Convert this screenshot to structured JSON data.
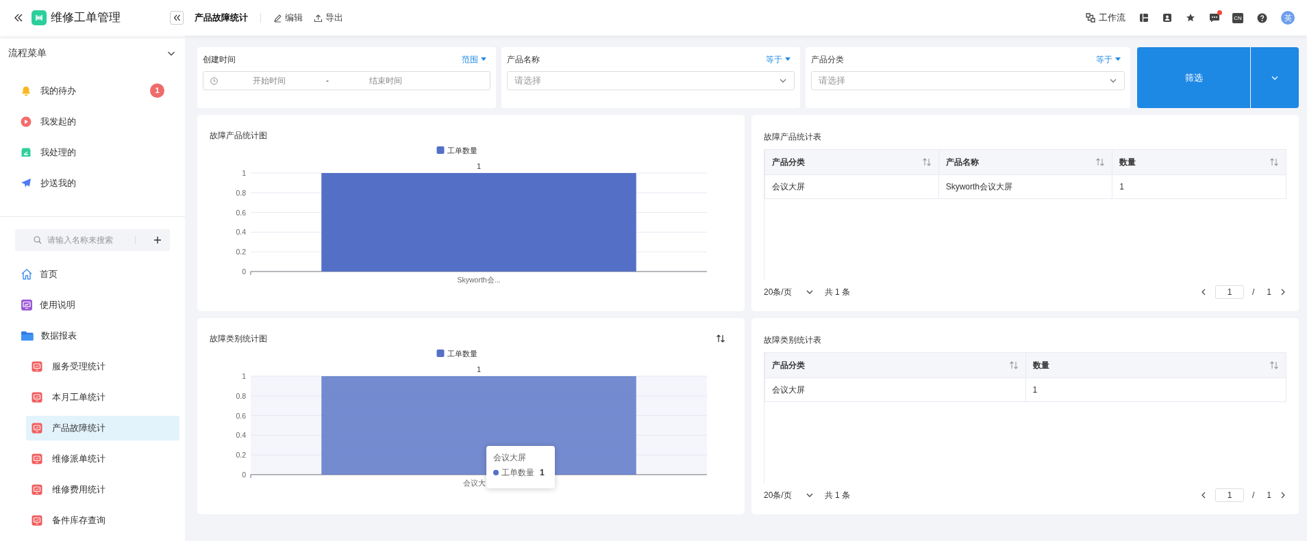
{
  "app": {
    "title": "维修工单管理"
  },
  "header": {
    "page_title": "产品故障统计",
    "actions": [
      {
        "label": "编辑",
        "kind": "edit"
      },
      {
        "label": "导出",
        "kind": "export"
      }
    ],
    "workflow": "工作流",
    "unread": true,
    "language": "CN",
    "avatar": "英"
  },
  "sidebar": {
    "process_menu": {
      "title": "流程菜单",
      "expanded": true,
      "items": [
        {
          "label": "我的待办",
          "kind": "todo",
          "badge": "1"
        },
        {
          "label": "我发起的",
          "kind": "started"
        },
        {
          "label": "我处理的",
          "kind": "handled"
        },
        {
          "label": "抄送我的",
          "kind": "cc"
        }
      ]
    },
    "search": {
      "placeholder": "请输入名称来搜索"
    },
    "nav": [
      {
        "label": "首页",
        "kind": "home",
        "selected": false
      },
      {
        "label": "使用说明",
        "kind": "doc",
        "selected": false
      },
      {
        "label": "数据报表",
        "kind": "folder",
        "expanded": true,
        "children": [
          {
            "label": "服务受理统计",
            "selected": false
          },
          {
            "label": "本月工单统计",
            "selected": false
          },
          {
            "label": "产品故障统计",
            "selected": true
          },
          {
            "label": "维修派单统计",
            "selected": false
          },
          {
            "label": "维修费用统计",
            "selected": false
          },
          {
            "label": "备件库存查询",
            "selected": false
          }
        ]
      }
    ]
  },
  "filters": [
    {
      "label": "创建时间",
      "operator": "范围",
      "kind": "date_range",
      "start_placeholder": "开始时间",
      "separator": "-",
      "end_placeholder": "结束时间"
    },
    {
      "label": "产品名称",
      "operator": "等于",
      "kind": "select",
      "placeholder": "请选择"
    },
    {
      "label": "产品分类",
      "operator": "等于",
      "kind": "select",
      "placeholder": "请选择"
    }
  ],
  "filter_button": "筛选",
  "panels": [
    {
      "kind": "chart",
      "title": "故障产品统计图",
      "sort_toggle": false,
      "highlighted": false,
      "chart_data": {
        "type": "bar",
        "categories": [
          "Skyworth会..."
        ],
        "series": [
          {
            "name": "工单数量",
            "color": "#5470c6",
            "values": [
              1
            ]
          }
        ],
        "grid": true,
        "ylim": [
          0,
          1
        ],
        "yticks": [
          0,
          0.2,
          0.4,
          0.6,
          0.8,
          1
        ],
        "data_labels": true
      }
    },
    {
      "kind": "table",
      "title": "故障产品统计表",
      "columns": [
        "产品分类",
        "产品名称",
        "数量"
      ],
      "rows": [
        [
          "会议大屏",
          "Skyworth会议大屏",
          "1"
        ]
      ],
      "pagination": {
        "page_size": "20条/页",
        "total": "共 1 条",
        "page": "1",
        "separator": "/",
        "pages": "1"
      }
    },
    {
      "kind": "chart",
      "title": "故障类别统计图",
      "sort_toggle": true,
      "highlighted": true,
      "chart_data": {
        "type": "bar",
        "categories": [
          "会议大"
        ],
        "series": [
          {
            "name": "工单数量",
            "color": "#5470c6",
            "values": [
              1
            ]
          }
        ],
        "grid": true,
        "ylim": [
          0,
          1
        ],
        "yticks": [
          0,
          0.2,
          0.4,
          0.6,
          0.8,
          1
        ],
        "data_labels": true
      },
      "tooltip": {
        "title": "会议大屏",
        "series": "工单数量",
        "value": "1"
      }
    },
    {
      "kind": "table",
      "title": "故障类别统计表",
      "columns": [
        "产品分类",
        "数量"
      ],
      "rows": [
        [
          "会议大屏",
          "1"
        ]
      ],
      "pagination": {
        "page_size": "20条/页",
        "total": "共 1 条",
        "page": "1",
        "separator": "/",
        "pages": "1"
      }
    }
  ]
}
